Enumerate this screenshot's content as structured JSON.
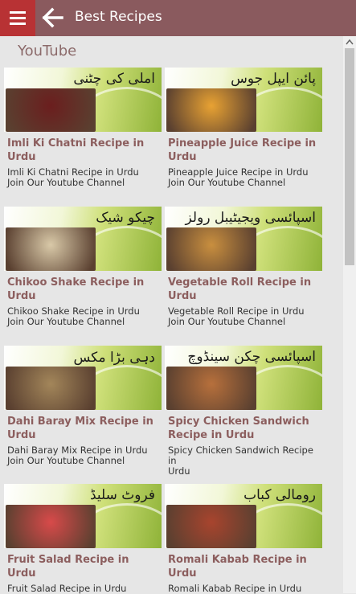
{
  "header": {
    "title": "Best Recipes",
    "menu_icon": "hamburger-icon",
    "back_icon": "back-arrow-icon",
    "bar_color": "#8a5a5e",
    "menu_color": "#b83234"
  },
  "section": {
    "title": "YouTube"
  },
  "cards": [
    {
      "urdu": "املی کی چٹنی",
      "title": "Imli Ki Chatni Recipe in Urdu",
      "desc": "Imli Ki Chatni Recipe in Urdu\nJoin Our Youtube Channel",
      "photo": "#6b1e1e"
    },
    {
      "urdu": "پائن ایپل جوس",
      "title": "Pineapple Juice Recipe in Urdu",
      "desc": "Pineapple Juice Recipe in Urdu\nJoin Our Youtube Channel",
      "photo": "#e8a233"
    },
    {
      "urdu": "چیکو شیک",
      "title": "Chikoo Shake Recipe in Urdu",
      "desc": "Chikoo Shake Recipe in Urdu\nJoin Our Youtube Channel",
      "photo": "#d9c9a8"
    },
    {
      "urdu": "اسپائسی ویجیٹیبل رولز",
      "title": "Vegetable Roll Recipe in Urdu",
      "desc": "Vegetable Roll Recipe in Urdu\nJoin Our Youtube Channel",
      "photo": "#c98f3f"
    },
    {
      "urdu": "دہی بڑا مکس",
      "title": "Dahi Baray Mix Recipe in Urdu",
      "desc": "Dahi Baray Mix Recipe in Urdu\nJoin Our Youtube Channel",
      "photo": "#a3865a"
    },
    {
      "urdu": "اسپائسی چکن سینڈوچ",
      "title": "Spicy Chicken Sandwich Recipe in Urdu",
      "desc": "Spicy Chicken Sandwich Recipe in\nUrdu",
      "photo": "#b7703c"
    },
    {
      "urdu": "فروٹ سلیڈ",
      "title": "Fruit Salad Recipe in Urdu",
      "desc": "Fruit Salad Recipe in Urdu",
      "photo": "#d84a4a"
    },
    {
      "urdu": "رومالی کباب",
      "title": "Romali Kabab Recipe in Urdu",
      "desc": "Romali Kabab Recipe in Urdu",
      "photo": "#a8442e"
    }
  ]
}
